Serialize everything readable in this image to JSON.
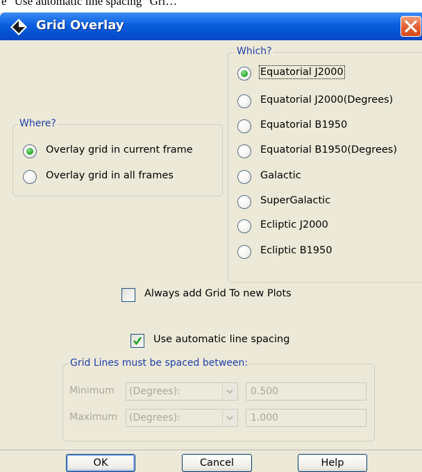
{
  "doc_fragment": "e \"Use automatic line spacing\" Gri…",
  "window": {
    "title": "Grid Overlay",
    "icons": {
      "app": "diamond-app-icon",
      "close": "close-icon"
    }
  },
  "where_group": {
    "legend": "Where?",
    "options": [
      {
        "label": "Overlay grid in current frame",
        "selected": true
      },
      {
        "label": "Overlay grid in all frames",
        "selected": false
      }
    ]
  },
  "which_group": {
    "legend": "Which?",
    "options": [
      {
        "label": "Equatorial J2000",
        "selected": true
      },
      {
        "label": "Equatorial J2000(Degrees)",
        "selected": false
      },
      {
        "label": "Equatorial B1950",
        "selected": false
      },
      {
        "label": "Equatorial B1950(Degrees)",
        "selected": false
      },
      {
        "label": "Galactic",
        "selected": false
      },
      {
        "label": "SuperGalactic",
        "selected": false
      },
      {
        "label": "Ecliptic J2000",
        "selected": false
      },
      {
        "label": "Ecliptic B1950",
        "selected": false
      }
    ]
  },
  "always_add_grid": {
    "label": "Always add Grid To new Plots",
    "checked": false
  },
  "auto_spacing": {
    "label": "Use automatic line spacing",
    "checked": true
  },
  "spacing_group": {
    "legend": "Grid Lines must be spaced between:",
    "minimum": {
      "label": "Minimum",
      "unit": "(Degrees):",
      "value": "0.500"
    },
    "maximum": {
      "label": "Maximum",
      "unit": "(Degrees):",
      "value": "1.000"
    }
  },
  "buttons": {
    "ok": "OK",
    "cancel": "Cancel",
    "help": "Help"
  },
  "colors": {
    "title_bar": "#0554d3",
    "legend_text": "#1f3fa7",
    "radio_selected": "#2fae2f",
    "checkmark": "#21a121",
    "close_button": "#e45c2f",
    "disabled_text": "#aca899"
  }
}
